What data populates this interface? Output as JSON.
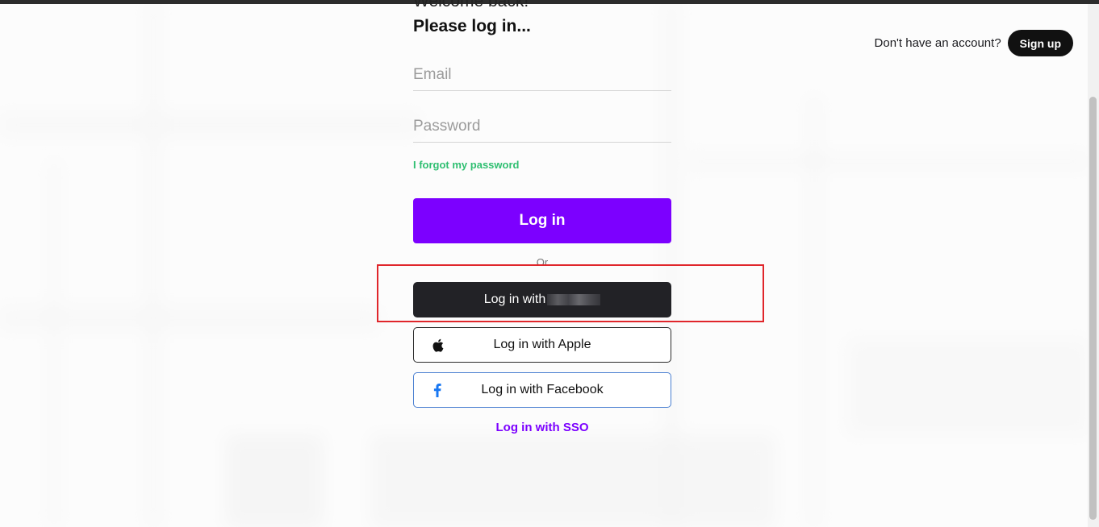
{
  "header": {
    "question": "Don't have an account?",
    "signup_label": "Sign up"
  },
  "form": {
    "welcome": "Welcome back!",
    "subtitle": "Please log in...",
    "email_placeholder": "Email",
    "password_placeholder": "Password",
    "forgot_label": "I forgot my password",
    "login_label": "Log in",
    "or_label": "Or",
    "google_label": "Log in with",
    "apple_label": "Log in with Apple",
    "facebook_label": "Log in with Facebook",
    "sso_label": "Log in with SSO"
  },
  "icons": {
    "apple": "apple-icon",
    "facebook": "facebook-icon"
  },
  "colors": {
    "primary": "#7c00ff",
    "link_green": "#2fbf71",
    "dark_button": "#222226",
    "facebook_blue": "#1877f2",
    "highlight": "#e0262b"
  }
}
